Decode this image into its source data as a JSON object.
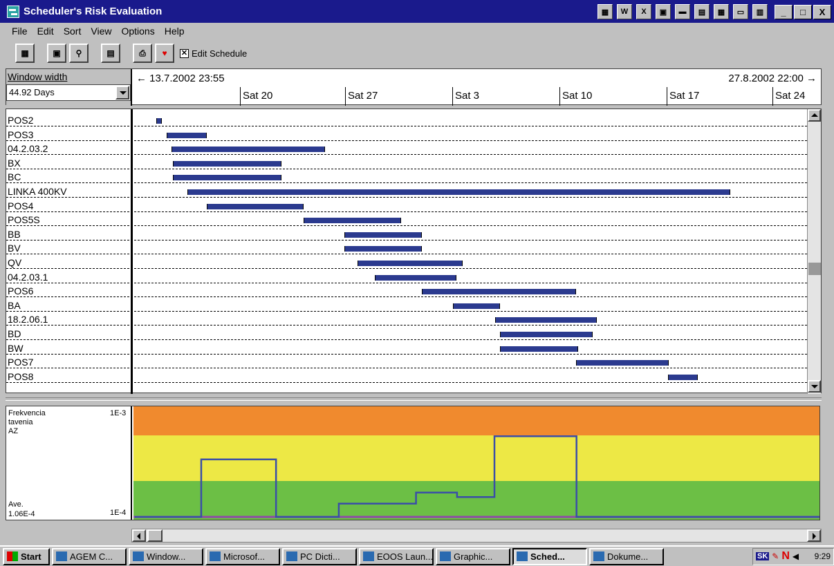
{
  "window": {
    "title": "Scheduler's Risk Evaluation"
  },
  "title_tray_icons": [
    "grid-icon",
    "word-icon",
    "excel-icon",
    "powerpoint-icon",
    "monitor-icon",
    "calendar-icon",
    "save-icon",
    "keyboard-icon",
    "chart-icon"
  ],
  "window_controls": {
    "minimize": "_",
    "maximize": "□",
    "close": "X"
  },
  "menu": [
    "File",
    "Edit",
    "Sort",
    "View",
    "Options",
    "Help"
  ],
  "toolbar": {
    "edit_schedule_label": "Edit Schedule",
    "edit_schedule_checked": true
  },
  "header": {
    "window_width_label": "Window width",
    "window_width_value": "44.92 Days",
    "range_start": "← 13.7.2002 23:55",
    "range_end": "27.8.2002 22:00 →",
    "date_ticks": [
      "Sat 20",
      "Sat 27",
      "Sat 3",
      "Sat 10",
      "Sat 17",
      "Sat 24"
    ]
  },
  "tasks": [
    {
      "name": "POS2",
      "start": 1.3,
      "end": 1.8
    },
    {
      "name": "POS3",
      "start": 2.2,
      "end": 5.5
    },
    {
      "name": "04.2.03.2",
      "start": 2.6,
      "end": 15.3
    },
    {
      "name": "BX",
      "start": 2.7,
      "end": 11.7
    },
    {
      "name": "BC",
      "start": 2.7,
      "end": 11.7
    },
    {
      "name": "LINKA 400KV",
      "start": 3.9,
      "end": 48.9
    },
    {
      "name": "POS4",
      "start": 5.5,
      "end": 13.5
    },
    {
      "name": "POS5S",
      "start": 13.5,
      "end": 21.6
    },
    {
      "name": "BB",
      "start": 16.9,
      "end": 23.3
    },
    {
      "name": "BV",
      "start": 16.9,
      "end": 23.3
    },
    {
      "name": "QV",
      "start": 18.0,
      "end": 26.7
    },
    {
      "name": "04.2.03.1",
      "start": 19.4,
      "end": 26.2
    },
    {
      "name": "POS6",
      "start": 23.3,
      "end": 36.1
    },
    {
      "name": "BA",
      "start": 25.9,
      "end": 29.8
    },
    {
      "name": "18.2.06.1",
      "start": 29.4,
      "end": 37.8
    },
    {
      "name": "BD",
      "start": 29.8,
      "end": 37.5
    },
    {
      "name": "BW",
      "start": 29.8,
      "end": 36.3
    },
    {
      "name": "POS7",
      "start": 36.1,
      "end": 43.8
    },
    {
      "name": "POS8",
      "start": 43.7,
      "end": 46.2
    }
  ],
  "risk_panel": {
    "label_line1": "Frekvencia",
    "label_line2": "tavenia",
    "label_line3": "AZ",
    "top_scale": "1E-3",
    "bottom_scale": "1E-4",
    "average_label": "Ave.",
    "average_value": "1.06E-4",
    "colors": {
      "high": "#f08a2e",
      "medium": "#ede845",
      "low": "#6cbf45",
      "line": "#3a4ea8",
      "baseline": "#8e4aa8"
    },
    "risk_steps": [
      {
        "day": 0,
        "level": 0.0
      },
      {
        "day": 5.5,
        "level": 0.52
      },
      {
        "day": 11.7,
        "level": 0.0
      },
      {
        "day": 16.9,
        "level": 0.12
      },
      {
        "day": 23.3,
        "level": 0.22
      },
      {
        "day": 26.7,
        "level": 0.18
      },
      {
        "day": 29.8,
        "level": 0.73
      },
      {
        "day": 36.6,
        "level": 0.0
      },
      {
        "day": 57.6,
        "level": 0.0
      }
    ]
  },
  "taskbar": {
    "start_label": "Start",
    "items": [
      {
        "label": "AGEM C...",
        "active": false
      },
      {
        "label": "Window...",
        "active": false
      },
      {
        "label": "Microsof...",
        "active": false
      },
      {
        "label": "PC Dicti...",
        "active": false
      },
      {
        "label": "EOOS Laun...",
        "active": false
      },
      {
        "label": "Graphic...",
        "active": false
      },
      {
        "label": "Sched...",
        "active": true
      },
      {
        "label": "Dokume...",
        "active": false
      }
    ],
    "tray_lang": "SK",
    "clock": "9:29"
  }
}
